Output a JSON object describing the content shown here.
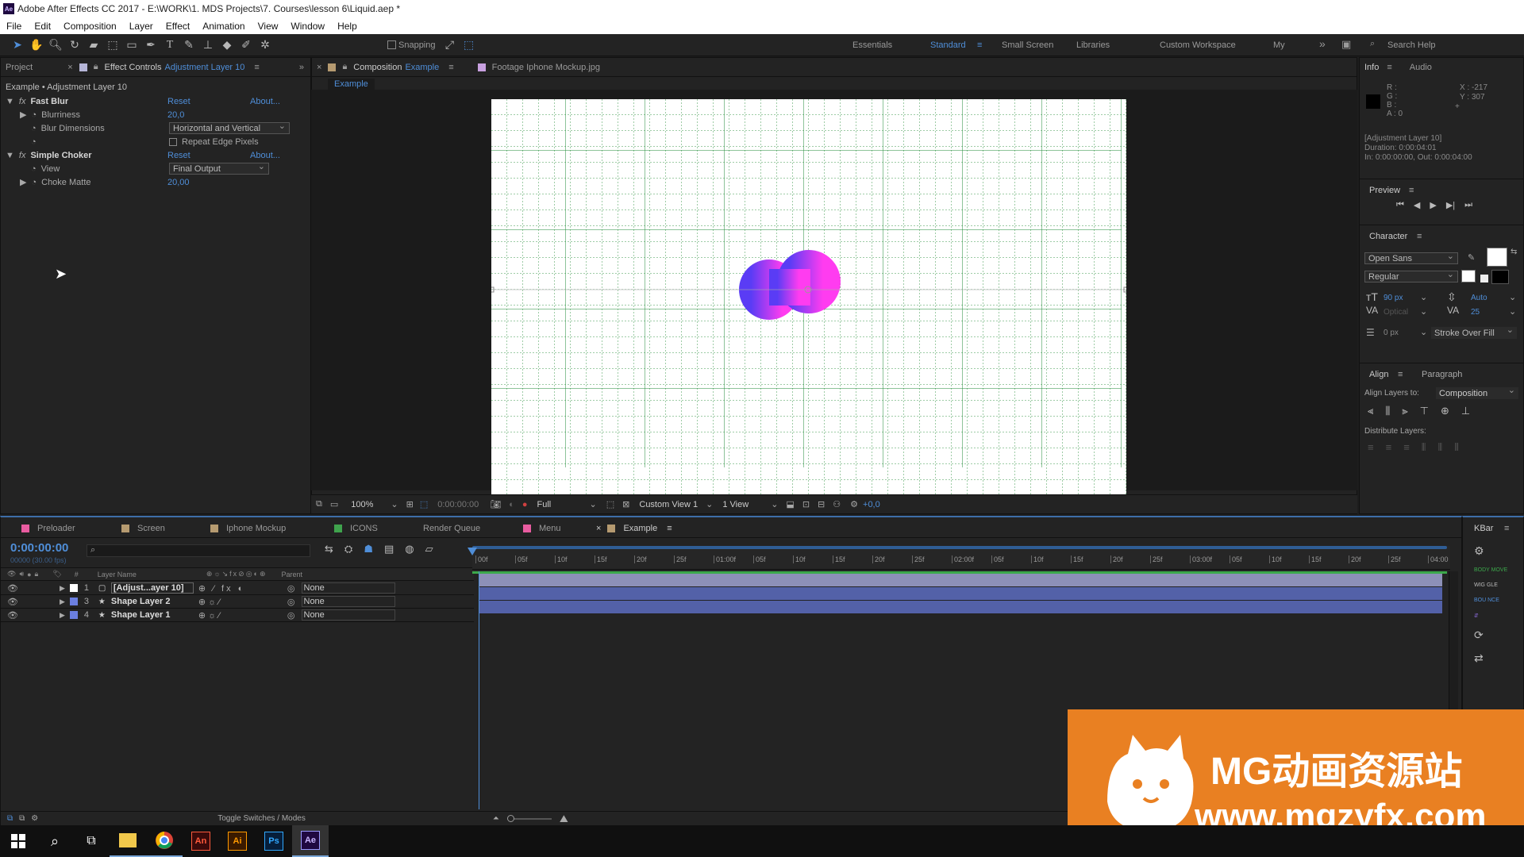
{
  "window": {
    "title": "Adobe After Effects CC 2017 - E:\\WORK\\1. MDS Projects\\7. Courses\\lesson 6\\Liquid.aep *",
    "logo": "Ae"
  },
  "menu": [
    "File",
    "Edit",
    "Composition",
    "Layer",
    "Effect",
    "Animation",
    "View",
    "Window",
    "Help"
  ],
  "toolbar": {
    "snapping_label": "Snapping",
    "workspaces": [
      "Essentials",
      "Standard",
      "Small Screen",
      "Libraries",
      "Custom Workspace",
      "My"
    ],
    "active_workspace": "Standard",
    "search_placeholder": "Search Help"
  },
  "project_panel": {
    "tab_project": "Project",
    "tab_effect_controls": "Effect Controls",
    "effect_layer": "Adjustment Layer 10",
    "breadcrumb": "Example • Adjustment Layer 10",
    "effects": [
      {
        "name": "Fast Blur",
        "reset": "Reset",
        "about": "About...",
        "props": [
          {
            "name": "Blurriness",
            "value": "20,0",
            "type": "number"
          },
          {
            "name": "Blur Dimensions",
            "value": "Horizontal and Vertical",
            "type": "dropdown"
          },
          {
            "name": "",
            "value": "Repeat Edge Pixels",
            "type": "checkbox",
            "checked": false
          }
        ]
      },
      {
        "name": "Simple Choker",
        "reset": "Reset",
        "about": "About...",
        "props": [
          {
            "name": "View",
            "value": "Final Output",
            "type": "dropdown"
          },
          {
            "name": "Choke Matte",
            "value": "20,00",
            "type": "number"
          }
        ]
      }
    ]
  },
  "comp_panel": {
    "tab_label": "Composition",
    "comp_name": "Example",
    "footage_tab": "Footage  Iphone Mockup.jpg",
    "subtab": "Example",
    "bottom_bar": {
      "zoom": "100%",
      "timecode": "0:00:00:00",
      "resolution": "Full",
      "view": "Custom View 1",
      "views": "1 View",
      "exposure": "+0,0"
    },
    "blob_colors": {
      "left": "#5a3cf5",
      "right": "#ff3cf0"
    }
  },
  "right_panels": {
    "info": {
      "tab_info": "Info",
      "tab_audio": "Audio",
      "r": "R :",
      "g": "G :",
      "b": "B :",
      "a": "A : 0",
      "x": "X : -217",
      "y": "Y : 307",
      "layer": "[Adjustment Layer 10]",
      "duration": "Duration: 0:00:04:01",
      "in_out": "In: 0:00:00:00, Out: 0:00:04:00"
    },
    "preview": {
      "title": "Preview"
    },
    "character": {
      "title": "Character",
      "font": "Open Sans",
      "style": "Regular",
      "size": "90 px",
      "leading": "Auto",
      "kerning": "Optical",
      "tracking": "25",
      "stroke": "0 px",
      "stroke_mode": "Stroke Over Fill"
    },
    "align": {
      "tab_align": "Align",
      "tab_paragraph": "Paragraph",
      "align_to_label": "Align Layers to:",
      "align_to_value": "Composition",
      "distribute_label": "Distribute Layers:"
    }
  },
  "timeline": {
    "tabs": [
      {
        "label": "Preloader",
        "color": "#e85ca0"
      },
      {
        "label": "Screen",
        "color": "#b59a70"
      },
      {
        "label": "Iphone Mockup",
        "color": "#b59a70"
      },
      {
        "label": "ICONS",
        "color": "#3fa34d"
      },
      {
        "label": "Render Queue",
        "color": ""
      },
      {
        "label": "Menu",
        "color": "#e85ca0"
      },
      {
        "label": "Example",
        "color": "#b59a70"
      }
    ],
    "active_tab": "Example",
    "timecode": "0:00:00:00",
    "fps": "00000 (30.00 fps)",
    "col_hash": "#",
    "col_layer_name": "Layer Name",
    "col_parent": "Parent",
    "layers": [
      {
        "num": "1",
        "name": "[Adjust...ayer 10]",
        "parent": "None",
        "color": "#ffffff",
        "kind": "adjust"
      },
      {
        "num": "3",
        "name": "Shape Layer 2",
        "parent": "None",
        "color": "#6b7fe0",
        "kind": "shape"
      },
      {
        "num": "4",
        "name": "Shape Layer 1",
        "parent": "None",
        "color": "#6b7fe0",
        "kind": "shape"
      }
    ],
    "ruler": [
      "00f",
      "05f",
      "10f",
      "15f",
      "20f",
      "25f",
      "01:00f",
      "05f",
      "10f",
      "15f",
      "20f",
      "25f",
      "02:00f",
      "05f",
      "10f",
      "15f",
      "20f",
      "25f",
      "03:00f",
      "05f",
      "10f",
      "15f",
      "20f",
      "25f",
      "04:00"
    ],
    "footer": "Toggle Switches / Modes",
    "kbar": "KBar"
  },
  "watermark": {
    "title": "MG动画资源站",
    "url": "www.mgzyfx.com"
  },
  "taskbar": [
    "start",
    "search",
    "task-view",
    "file-explorer",
    "chrome",
    "Animate",
    "Illustrator",
    "Photoshop",
    "After Effects"
  ],
  "taskbar_labels": {
    "an": "An",
    "ai": "Ai",
    "ps": "Ps",
    "ae": "Ae"
  }
}
